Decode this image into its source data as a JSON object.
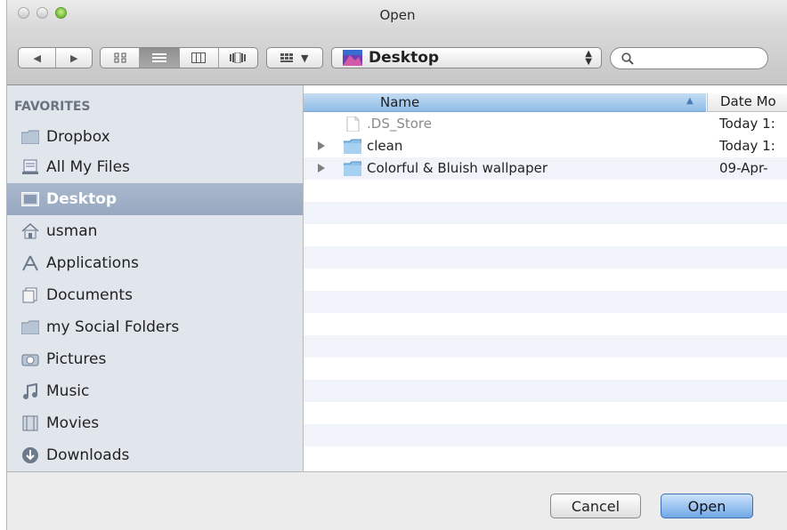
{
  "window": {
    "title": "Open"
  },
  "toolbar": {
    "location": "Desktop",
    "search_placeholder": "",
    "view_modes": [
      "icon-view",
      "list-view",
      "column-view",
      "coverflow-view"
    ],
    "active_view": "list-view"
  },
  "sidebar": {
    "header": "FAVORITES",
    "items": [
      {
        "label": "Dropbox",
        "icon": "folder-icon"
      },
      {
        "label": "All My Files",
        "icon": "all-files-icon"
      },
      {
        "label": "Desktop",
        "icon": "desktop-icon",
        "selected": true
      },
      {
        "label": "usman",
        "icon": "home-icon"
      },
      {
        "label": "Applications",
        "icon": "applications-icon"
      },
      {
        "label": "Documents",
        "icon": "documents-icon"
      },
      {
        "label": "my Social Folders",
        "icon": "folder-icon"
      },
      {
        "label": "Pictures",
        "icon": "camera-icon"
      },
      {
        "label": "Music",
        "icon": "music-icon"
      },
      {
        "label": "Movies",
        "icon": "film-icon"
      },
      {
        "label": "Downloads",
        "icon": "download-icon"
      }
    ]
  },
  "files": {
    "col_name": "Name",
    "col_date": "Date Mo",
    "rows": [
      {
        "name": ".DS_Store",
        "date": "Today 1:",
        "type": "file",
        "dimmed": true
      },
      {
        "name": "clean",
        "date": "Today 1:",
        "type": "folder"
      },
      {
        "name": "Colorful & Bluish wallpaper",
        "date": "09-Apr-",
        "type": "folder"
      }
    ]
  },
  "buttons": {
    "cancel": "Cancel",
    "open": "Open"
  },
  "colors": {
    "selection": "#9aabc3",
    "sidebar_bg": "#e1e6ed",
    "header_blue": "#8fbde7",
    "default_button": "#6fa7e6"
  }
}
